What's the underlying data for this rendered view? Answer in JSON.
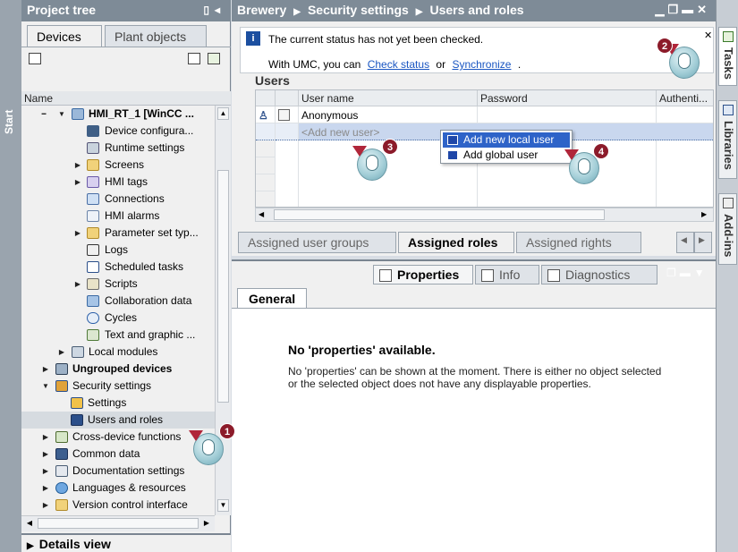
{
  "start_strip": {
    "label": "Start"
  },
  "project_tree": {
    "title": "Project tree",
    "tabs": [
      "Devices",
      "Plant objects"
    ],
    "column_header": "Name",
    "items": [
      {
        "label": "HMI_RT_1 [WinCC ...",
        "bold": true,
        "icon": "hmi-device-icon"
      },
      {
        "label": "Device configura...",
        "icon": "device-config-icon"
      },
      {
        "label": "Runtime settings",
        "icon": "runtime-settings-icon"
      },
      {
        "label": "Screens",
        "icon": "folder-icon"
      },
      {
        "label": "HMI tags",
        "icon": "hmi-tags-icon"
      },
      {
        "label": "Connections",
        "icon": "connections-icon"
      },
      {
        "label": "HMI alarms",
        "icon": "alarm-envelope-icon"
      },
      {
        "label": "Parameter set typ...",
        "icon": "folder-icon"
      },
      {
        "label": "Logs",
        "icon": "logs-icon"
      },
      {
        "label": "Scheduled tasks",
        "icon": "scheduled-tasks-icon"
      },
      {
        "label": "Scripts",
        "icon": "scripts-icon"
      },
      {
        "label": "Collaboration data",
        "icon": "collaboration-icon"
      },
      {
        "label": "Cycles",
        "icon": "cycles-icon"
      },
      {
        "label": "Text and graphic ...",
        "icon": "text-graphic-icon"
      },
      {
        "label": "Local modules",
        "icon": "local-modules-icon"
      },
      {
        "label": "Ungrouped devices",
        "bold": true,
        "icon": "ungrouped-devices-icon"
      },
      {
        "label": "Security settings",
        "icon": "security-settings-icon"
      },
      {
        "label": "Settings",
        "icon": "key-settings-icon"
      },
      {
        "label": "Users and roles",
        "icon": "users-roles-icon",
        "selected": true
      },
      {
        "label": "Cross-device functions",
        "icon": "cross-device-icon"
      },
      {
        "label": "Common data",
        "icon": "common-data-icon"
      },
      {
        "label": "Documentation settings",
        "icon": "documentation-icon"
      },
      {
        "label": "Languages & resources",
        "icon": "languages-icon"
      },
      {
        "label": "Version control interface",
        "icon": "version-control-icon"
      }
    ]
  },
  "details_view": {
    "label": "Details view"
  },
  "editor": {
    "breadcrumb": [
      "Brewery",
      "Security settings",
      "Users and roles"
    ],
    "info": {
      "line1": "The current status has not yet been checked.",
      "line2_prefix": "With UMC, you can",
      "link1": "Check status",
      "or": "or",
      "link2": "Synchronize",
      "dot": "."
    },
    "section_title": "Users",
    "columns": [
      "User name",
      "Password",
      "Authenti..."
    ],
    "rows": [
      {
        "name": "Anonymous",
        "password": ""
      }
    ],
    "add_placeholder": "<Add new user>",
    "context_menu": [
      "Add new local user",
      "Add global user"
    ],
    "tabs": [
      "Assigned user groups",
      "Assigned roles",
      "Assigned rights"
    ]
  },
  "properties": {
    "tabs": [
      "Properties",
      "Info",
      "Diagnostics"
    ],
    "general_tab": "General",
    "title": "No 'properties' available.",
    "text": "No 'properties' can be shown at the moment. There is either no object selected or the selected object does not have any displayable properties."
  },
  "right_strip": {
    "tabs": [
      "Tasks",
      "Libraries",
      "Add-ins"
    ]
  },
  "callouts": [
    "1",
    "2",
    "3",
    "4"
  ],
  "colors": {
    "header_bar": "#7e8b97",
    "highlight": "#2e63c8",
    "callout": "#8c1b2a"
  }
}
